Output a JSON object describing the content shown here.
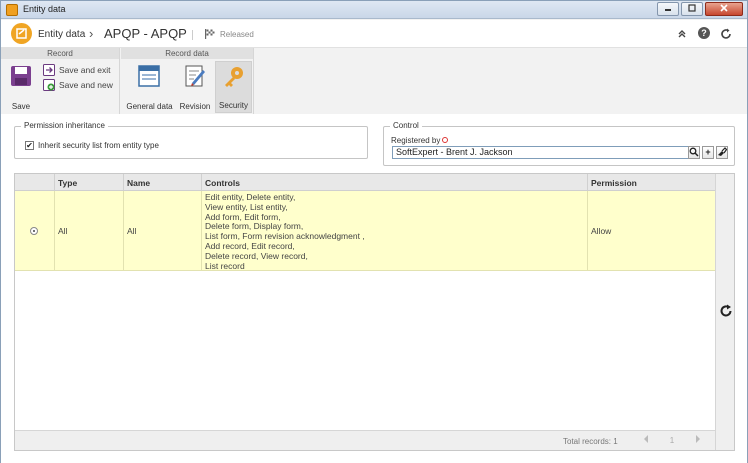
{
  "window": {
    "title": "Entity data"
  },
  "header": {
    "entity_label": "Entity data",
    "separator": "›",
    "record_title": "APQP - APQP",
    "status": "Released"
  },
  "ribbon": {
    "groups": [
      {
        "title": "Record"
      },
      {
        "title": "Record data"
      }
    ],
    "save_label": "Save",
    "save_exit_label": "Save and exit",
    "save_new_label": "Save and new",
    "general_data_label": "General data",
    "revision_label": "Revision",
    "security_label": "Security"
  },
  "permission": {
    "legend": "Permission inheritance",
    "inherit_label": "Inherit security list from entity type",
    "inherit_checked": true,
    "check_mark": "✔"
  },
  "control": {
    "legend": "Control",
    "registered_by_label": "Registered by",
    "registered_by_value": "SoftExpert - Brent J. Jackson",
    "add_label": "+"
  },
  "grid": {
    "columns": [
      "Type",
      "Name",
      "Controls",
      "Permission"
    ],
    "rows": [
      {
        "type": "All",
        "name": "All",
        "controls": [
          "Edit entity, Delete entity,",
          "View entity, List entity,",
          "Add form, Edit form,",
          "Delete form, Display form,",
          "List form, Form revision acknowledgment ,",
          "Add record, Edit record,",
          "Delete record, View record,",
          "List record"
        ],
        "permission": "Allow"
      }
    ],
    "total_records": "Total records: 1",
    "page": "1"
  },
  "colors": {
    "selected_row": "#ffffcc",
    "logo_orange": "#f0a524",
    "security_key": "#e8a030"
  }
}
